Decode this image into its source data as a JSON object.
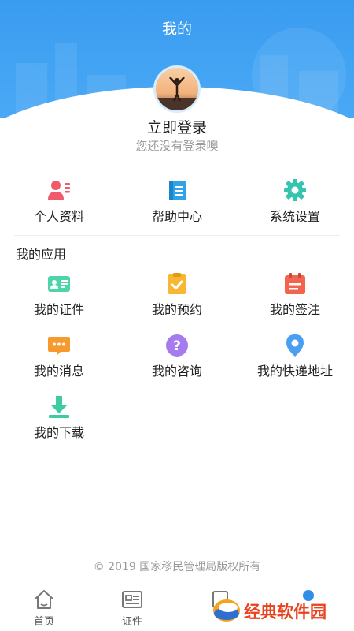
{
  "header": {
    "title": "我的",
    "bg_color": "#3a9cf0"
  },
  "profile": {
    "login_label": "立即登录",
    "login_hint": "您还没有登录噢"
  },
  "quick_actions": [
    {
      "label": "个人资料",
      "icon": "profile-card-icon",
      "color": "#f05a6a"
    },
    {
      "label": "帮助中心",
      "icon": "help-book-icon",
      "color": "#2ea3e8"
    },
    {
      "label": "系统设置",
      "icon": "gear-icon",
      "color": "#35c4b0"
    }
  ],
  "apps": {
    "section_title": "我的应用",
    "items": [
      {
        "label": "我的证件",
        "icon": "id-card-icon",
        "color": "#4fd3a8"
      },
      {
        "label": "我的预约",
        "icon": "clipboard-check-icon",
        "color": "#f7b733"
      },
      {
        "label": "我的签注",
        "icon": "calendar-icon",
        "color": "#f2644e"
      },
      {
        "label": "我的消息",
        "icon": "chat-bubble-icon",
        "color": "#f79a2e"
      },
      {
        "label": "我的咨询",
        "icon": "question-icon",
        "color": "#a57bef"
      },
      {
        "label": "我的快递地址",
        "icon": "location-pin-icon",
        "color": "#4a9ff2"
      },
      {
        "label": "我的下载",
        "icon": "download-icon",
        "color": "#3ccba3"
      }
    ]
  },
  "footer": {
    "copyright": "© 2019 国家移民管理局版权所有"
  },
  "tabbar": {
    "tabs": [
      {
        "label": "首页",
        "icon": "home-icon"
      },
      {
        "label": "证件",
        "icon": "document-icon"
      },
      {
        "label": "",
        "icon": "card-icon"
      },
      {
        "label": "",
        "icon": "user-icon"
      }
    ]
  },
  "watermark": {
    "text": "经典软件园"
  }
}
